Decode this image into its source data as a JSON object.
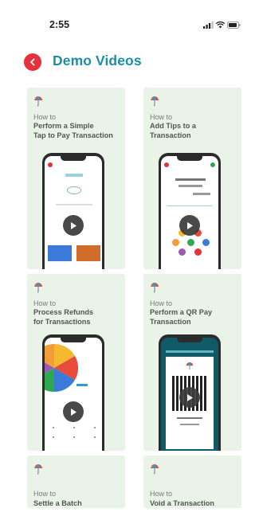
{
  "status_bar": {
    "time": "2:55"
  },
  "header": {
    "title": "Demo Videos"
  },
  "videos": [
    {
      "how_to": "How to",
      "title_line1": "Perform a Simple",
      "title_line2": "Tap to Pay Transaction"
    },
    {
      "how_to": "How to",
      "title_line1": "Add Tips to a",
      "title_line2": "Transaction"
    },
    {
      "how_to": "How to",
      "title_line1": "Process Refunds",
      "title_line2": "for Transactions"
    },
    {
      "how_to": "How to",
      "title_line1": "Perform a QR Pay",
      "title_line2": "Transaction"
    },
    {
      "how_to": "How to",
      "title_line1": "Settle a Batch",
      "title_line2": ""
    },
    {
      "how_to": "How to",
      "title_line1": "Void a Transaction",
      "title_line2": ""
    }
  ],
  "colors": {
    "accent": "#1a8fa6",
    "back": "#e5313c",
    "card_bg": "#eaf3e8"
  }
}
